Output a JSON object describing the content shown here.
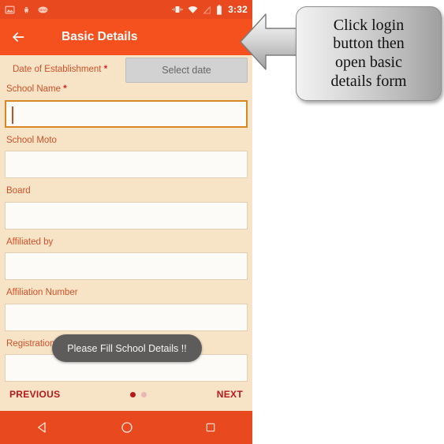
{
  "status_bar": {
    "icons_left": [
      "image-icon",
      "android-robot-icon",
      "news-icon"
    ],
    "icons_right": [
      "vibrate-icon",
      "wifi-icon",
      "signal-off-icon",
      "battery-icon"
    ],
    "clock": "3:32"
  },
  "app_bar": {
    "back_icon": "back-arrow-icon",
    "title": "Basic Details"
  },
  "form": {
    "date_row": {
      "label": "Date of Establishment",
      "required_mark": "*",
      "button_label": "Select date"
    },
    "fields": [
      {
        "label": "School Name",
        "required_mark": "*",
        "value": "",
        "focused": true
      },
      {
        "label": "School Moto",
        "required_mark": "",
        "value": "",
        "focused": false
      },
      {
        "label": "Board",
        "required_mark": "",
        "value": "",
        "focused": false
      },
      {
        "label": "Affiliated by",
        "required_mark": "",
        "value": "",
        "focused": false
      },
      {
        "label": "Affiliation Number",
        "required_mark": "",
        "value": "",
        "focused": false
      },
      {
        "label": "Registration Number",
        "required_mark": "",
        "value": "",
        "focused": false
      }
    ]
  },
  "toast": {
    "message": "Please Fill School Details !!"
  },
  "pager": {
    "previous_label": "PREVIOUS",
    "next_label": "NEXT",
    "dots_total": 2,
    "dot_active_index": 0
  },
  "nav_bar": {
    "back_icon": "nav-back-triangle-icon",
    "home_icon": "nav-home-circle-icon",
    "recents_icon": "nav-recents-square-icon"
  },
  "callout": {
    "text": "Click login\nbutton then\nopen basic\ndetails  form",
    "arrow_icon": "left-arrow-callout-icon"
  },
  "colors": {
    "status_bar": "#e8491f",
    "app_bar": "#f4511e",
    "form_bg": "#f7e3c6",
    "label": "#d2522a",
    "required": "#e02020",
    "focus_border": "#d98724",
    "pager_text": "#b81a1a",
    "toast_bg": "#5d5c5b"
  }
}
